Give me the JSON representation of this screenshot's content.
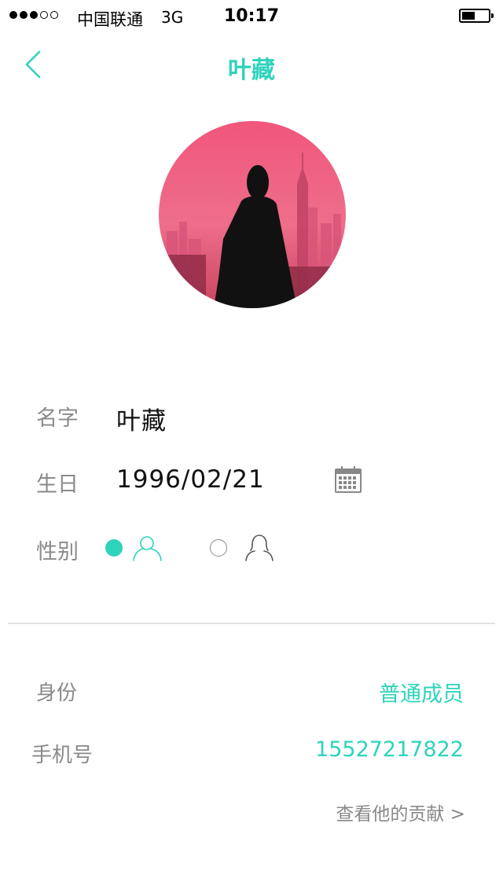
{
  "status_bar": {
    "carrier": "中国联通",
    "network": "3G",
    "time": "10:17",
    "signal_bars_filled": 3,
    "signal_bars_total": 5,
    "battery_level": 0.5
  },
  "nav": {
    "title": "叶藏",
    "back_icon": "chevron-left-icon"
  },
  "colors": {
    "accent": "#2ed3bb",
    "label": "#8a8a8a",
    "avatar_tint": "#ee5a7a"
  },
  "profile": {
    "name_label": "名字",
    "name_value": "叶藏",
    "birthday_label": "生日",
    "birthday_value": "1996/02/21",
    "calendar_icon": "calendar-icon",
    "gender_label": "性别",
    "gender_options": [
      {
        "icon": "male-user-icon",
        "selected": true
      },
      {
        "icon": "female-user-icon",
        "selected": false
      }
    ]
  },
  "details": {
    "role_label": "身份",
    "role_value": "普通成员",
    "phone_label": "手机号",
    "phone_value": "15527217822",
    "contribution_link": "查看他的贡献 >"
  }
}
